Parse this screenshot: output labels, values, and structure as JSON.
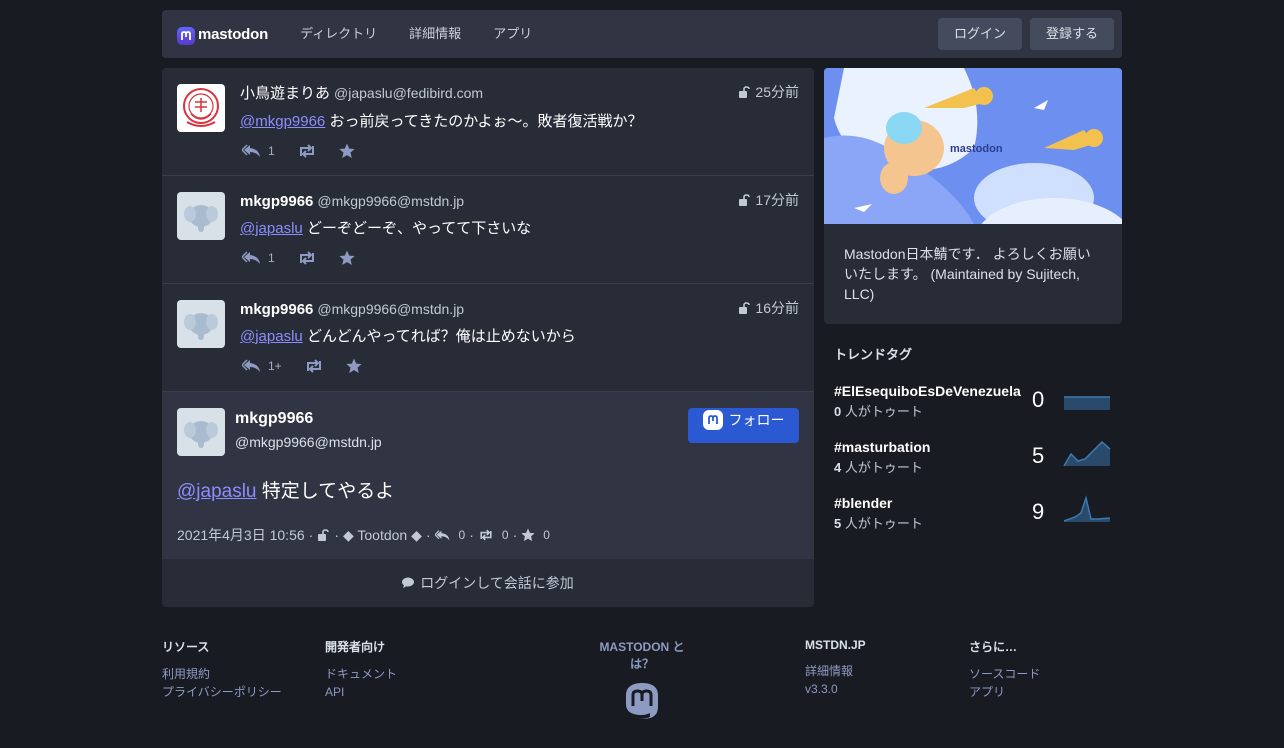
{
  "header": {
    "logo_text": "mastodon",
    "nav": [
      "ディレクトリ",
      "詳細情報",
      "アプリ"
    ],
    "login": "ログイン",
    "signup": "登録する"
  },
  "statuses": [
    {
      "display_name": "小鳥遊まりあ",
      "acct": "@japaslu@fedibird.com",
      "time": "25分前",
      "mention": "@mkgp9966",
      "text": "おっ前戻ってきたのかよぉ〜。敗者復活戦か？",
      "replies": "1"
    },
    {
      "display_name": "mkgp9966",
      "acct": "@mkgp9966@mstdn.jp",
      "time": "17分前",
      "mention": "@japaslu",
      "text": "どーぞどーぞ、やってて下さいな",
      "replies": "1"
    },
    {
      "display_name": "mkgp9966",
      "acct": "@mkgp9966@mstdn.jp",
      "time": "16分前",
      "mention": "@japaslu",
      "text": "どんどんやってれば？俺は止めないから",
      "replies": "1+"
    }
  ],
  "detailed": {
    "display_name": "mkgp9966",
    "acct": "@mkgp9966@mstdn.jp",
    "follow": "フォロー",
    "mention": "@japaslu",
    "text": "特定してやるよ",
    "date": "2021年4月3日 10:56",
    "app": "◆ Tootdon ◆",
    "replies": "0",
    "reblogs": "0",
    "favourites": "0",
    "sep": "·"
  },
  "join_label": "ログインして会話に参加",
  "sidebar": {
    "hero_logo": "mastodon",
    "description": "Mastodon日本鯖です． よろしくお願いいたします。 (Maintained by Sujitech, LLC)",
    "trends_title": "トレンドタグ",
    "trends": [
      {
        "tag": "#ElEsequiboEsDeVenezuela",
        "people": "0",
        "suffix": "人がトゥート",
        "count": "0"
      },
      {
        "tag": "#masturbation",
        "people": "4",
        "suffix": "人がトゥート",
        "count": "5"
      },
      {
        "tag": "#blender",
        "people": "5",
        "suffix": "人がトゥート",
        "count": "9"
      }
    ]
  },
  "footer": {
    "resources": {
      "title": "リソース",
      "links": [
        "利用規約",
        "プライバシーポリシー"
      ]
    },
    "developers": {
      "title": "開発者向け",
      "links": [
        "ドキュメント",
        "API"
      ]
    },
    "about": {
      "title": "MASTODON とは？"
    },
    "instance": {
      "title": "MSTDN.JP",
      "links": [
        "詳細情報",
        "v3.3.0"
      ]
    },
    "more": {
      "title": "さらに…",
      "links": [
        "ソースコード",
        "アプリ"
      ]
    }
  },
  "colors": {
    "background": "#191b22",
    "panel": "#282c37",
    "header": "#313543",
    "accent": "#2b59d1",
    "mention": "#8c8dff"
  }
}
